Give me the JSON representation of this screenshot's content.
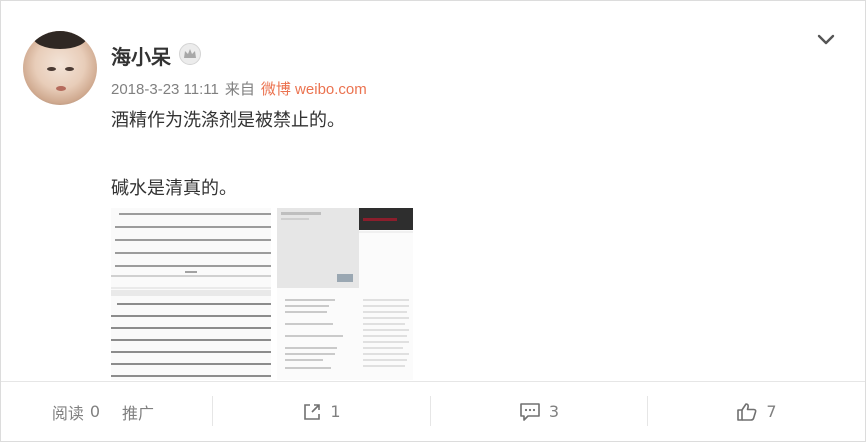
{
  "post": {
    "username": "海小呆",
    "timestamp": "2018-3-23 11:11",
    "via_prefix": "来自",
    "source": "微博 weibo.com",
    "text_line1": "酒精作为洗涤剂是被禁止的。",
    "text_line2": "碱水是清真的。"
  },
  "icons": {
    "badge": "crown-icon",
    "menu": "chevron-down-icon",
    "share": "share-icon",
    "comment": "comment-icon",
    "like": "thumbs-up-icon"
  },
  "actions": {
    "read_label": "阅读",
    "read_count": "0",
    "promote_label": "推广",
    "share_count": "1",
    "comment_count": "3",
    "like_count": "7"
  },
  "colors": {
    "source_link": "#eb7350",
    "meta_text": "#808080",
    "body_text": "#333333"
  }
}
